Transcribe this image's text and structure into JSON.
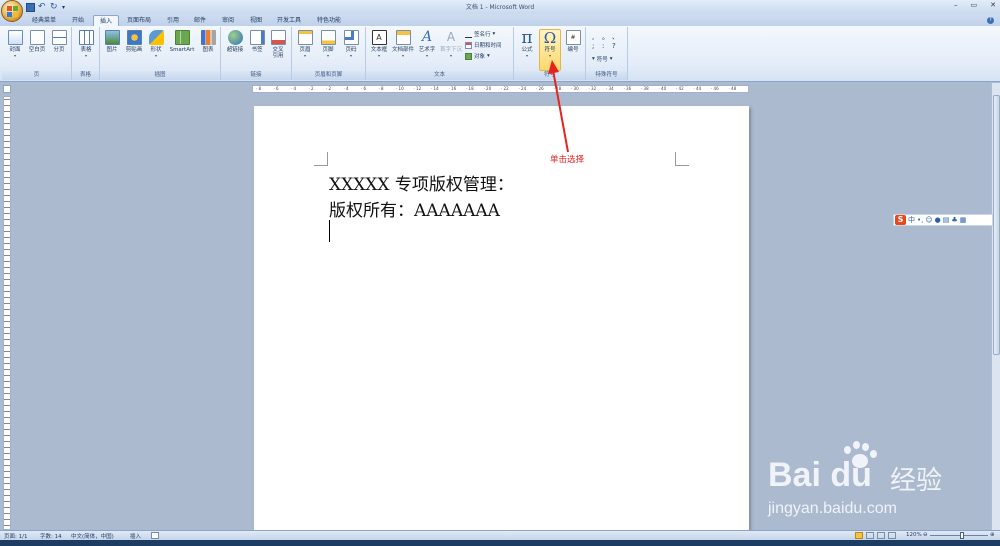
{
  "window": {
    "title": "文档 1 - Microsoft Word",
    "controls": [
      "–",
      "▭",
      "✕"
    ]
  },
  "tabs": [
    {
      "label": "经典菜单",
      "active": false
    },
    {
      "label": "开始",
      "active": false
    },
    {
      "label": "插入",
      "active": true
    },
    {
      "label": "页面布局",
      "active": false
    },
    {
      "label": "引用",
      "active": false
    },
    {
      "label": "邮件",
      "active": false
    },
    {
      "label": "审阅",
      "active": false
    },
    {
      "label": "视图",
      "active": false
    },
    {
      "label": "开发工具",
      "active": false
    },
    {
      "label": "特色功能",
      "active": false
    }
  ],
  "ribbon": {
    "page_group": {
      "label": "页",
      "buttons": [
        "封面",
        "空白页",
        "分页"
      ]
    },
    "table_group": {
      "label": "表格",
      "buttons": [
        "表格"
      ]
    },
    "illus_group": {
      "label": "插图",
      "buttons": [
        "图片",
        "剪贴画",
        "形状",
        "SmartArt",
        "图表"
      ]
    },
    "link_group": {
      "label": "链接",
      "buttons": [
        "超链接",
        "书签",
        "交叉",
        "引用"
      ]
    },
    "hf_group": {
      "label": "页眉和页脚",
      "buttons": [
        "页眉",
        "页脚",
        "页码"
      ]
    },
    "text_group": {
      "label": "文本",
      "buttons": [
        "文本框",
        "文档部件",
        "艺术字",
        "首字下沉"
      ],
      "small": [
        "签名行",
        "日期和时间",
        "对象"
      ]
    },
    "symbol_group": {
      "label": "符号",
      "buttons": [
        "公式",
        "符号",
        "编号"
      ],
      "glyphs": [
        "π",
        "Ω"
      ]
    },
    "special_group": {
      "label": "特殊符号",
      "glyphs": [
        ",",
        "。",
        "、",
        ";",
        ":",
        "?"
      ],
      "more": "符号"
    }
  },
  "document": {
    "lines": [
      "XXXXX 专项版权管理：",
      "版权所有：AAAAAAA"
    ]
  },
  "ruler_marks": [
    "8",
    "6",
    "4",
    "2",
    "2",
    "4",
    "6",
    "8",
    "10",
    "12",
    "14",
    "16",
    "18",
    "20",
    "22",
    "24",
    "26",
    "28",
    "30",
    "32",
    "34",
    "36",
    "38",
    "40",
    "42",
    "44",
    "46",
    "48"
  ],
  "annotation": {
    "text": "单击选择",
    "color": "#e8221d"
  },
  "ime": {
    "brand": "S",
    "lang": "中",
    "punct": "•,"
  },
  "watermark": {
    "logo": "Bai du",
    "cn": "经验",
    "url": "jingyan.baidu.com"
  },
  "status": {
    "page": "页面: 1/1",
    "words": "字数: 14",
    "language": "中文(简体，中国)",
    "mode": "插入",
    "zoom": "120%"
  },
  "colors": {
    "accent": "#1e395b",
    "active_tab": "#f2f7fd",
    "highlight": "#ffd86b"
  }
}
